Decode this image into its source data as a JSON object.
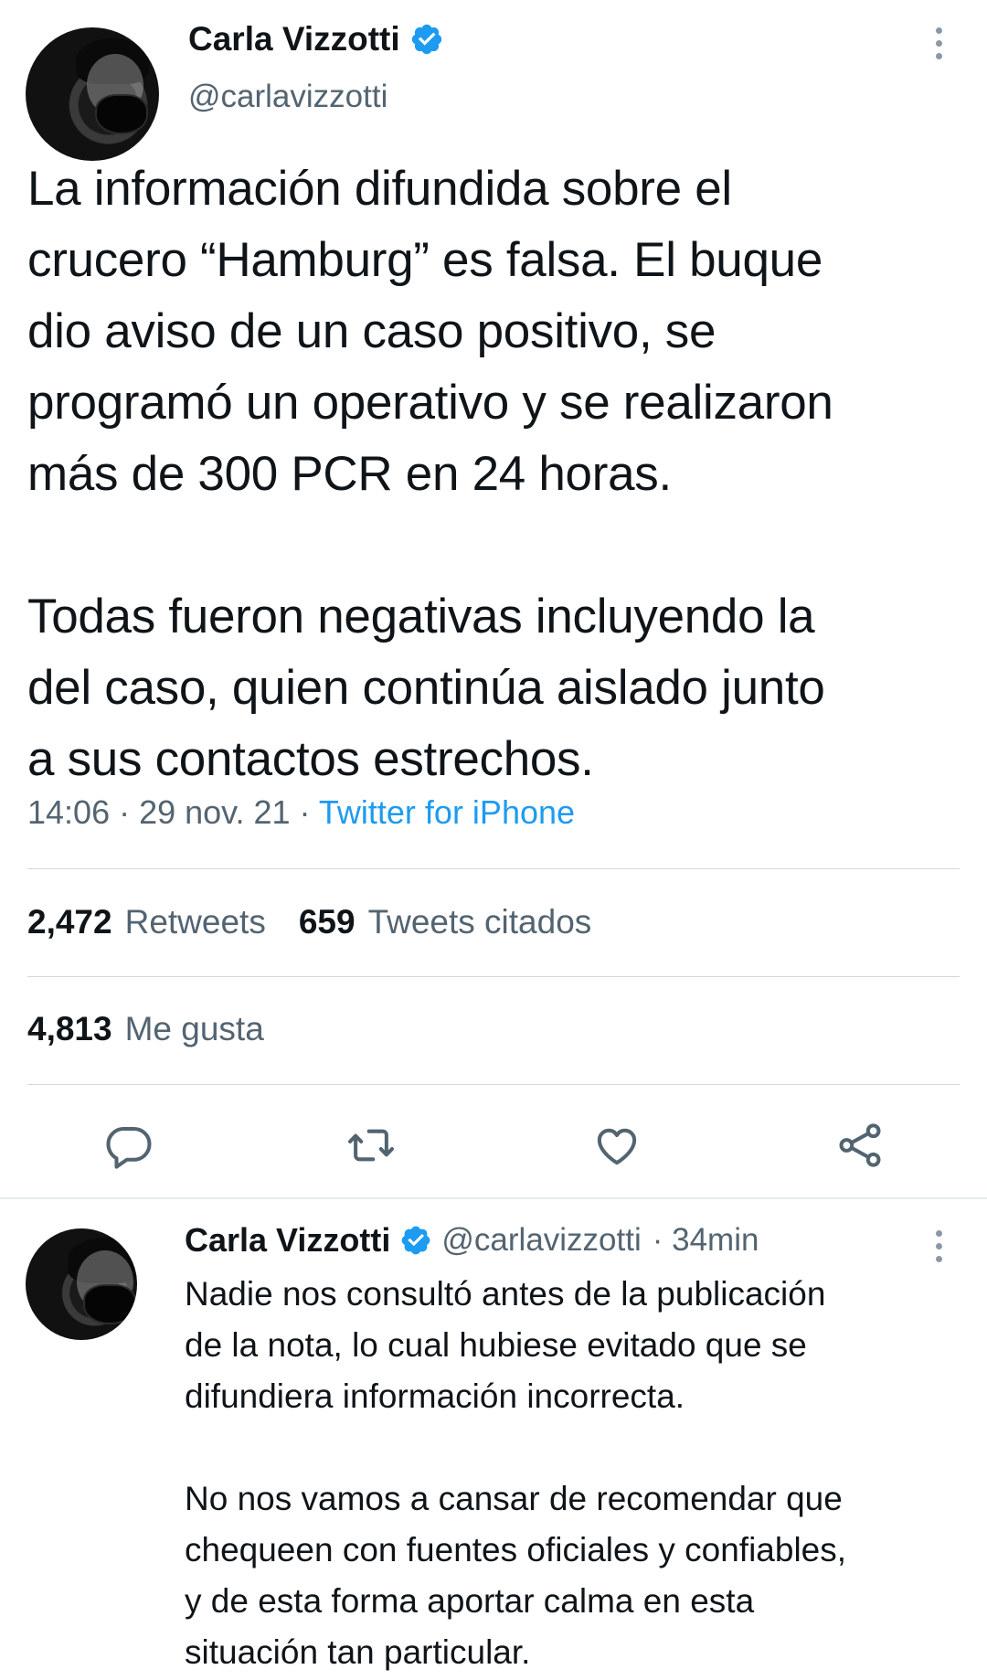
{
  "tweet": {
    "author_name": "Carla Vizzotti",
    "author_handle": "@carlavizzotti",
    "text": "La información difundida sobre el\ncrucero “Hamburg” es falsa. El buque\ndio aviso de un caso positivo, se\nprogramó un operativo y se realizaron\nmás de 300 PCR en 24 horas.\n\nTodas fueron negativas incluyendo la\ndel caso, quien continúa aislado junto\na sus contactos estrechos.",
    "timestamp": "14:06 · 29 nov. 21 ·",
    "source": "Twitter for iPhone",
    "retweets_count": "2,472",
    "retweets_label": "Retweets",
    "quotes_count": "659",
    "quotes_label": "Tweets citados",
    "likes_count": "4,813",
    "likes_label": "Me gusta"
  },
  "actions": {
    "reply_icon": "reply-icon",
    "retweet_icon": "retweet-icon",
    "like_icon": "like-icon",
    "share_icon": "share-icon"
  },
  "reply": {
    "author_name": "Carla Vizzotti",
    "author_handle": "@carlavizzotti",
    "time_ago": "· 34min",
    "text": "Nadie nos consultó antes de la publicación\nde la nota, lo cual hubiese evitado que se\ndifundiera información incorrecta.\n\nNo nos vamos a cansar de recomendar que\nchequeen con fuentes oficiales y confiables,\ny de esta forma aportar calma en esta\nsituación tan particular."
  },
  "colors": {
    "text": "#0f1419",
    "secondary": "#536471",
    "link": "#1d9bf0",
    "verified": "#1d9bf0",
    "divider": "#cfd9de"
  }
}
